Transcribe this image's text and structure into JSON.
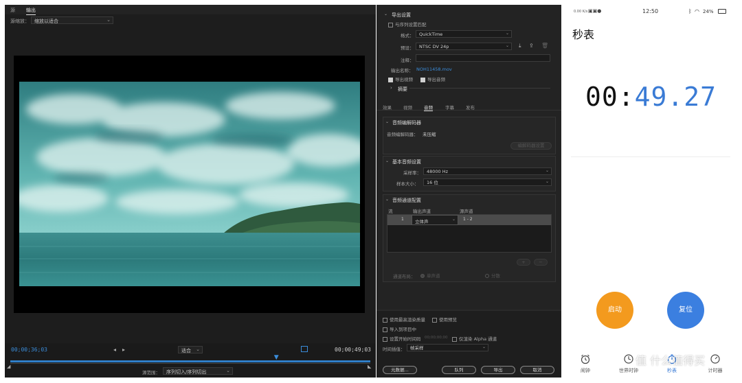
{
  "left_panel": {
    "tabs": [
      "源",
      "输出"
    ],
    "source_scale_label": "源缩放：",
    "source_scale_value": "缩放以适合",
    "timecode_current": "00;00;36;03",
    "timecode_end": "00;00;49;03",
    "fit_value": "适合",
    "source_range_label": "源范围：",
    "source_range_value": "序列切入/序列切出",
    "playhead_progress": 0.74
  },
  "export_settings": {
    "section_title": "导出设置",
    "match_sequence_label": "与序列设置匹配",
    "format_label": "格式：",
    "format_value": "QuickTime",
    "preset_label": "预设：",
    "preset_value": "NTSC DV 24p",
    "comment_label": "注释：",
    "comment_value": "",
    "output_name_label": "输出名称：",
    "output_name_value": "NOH11458.mov",
    "export_video_label": "导出视频",
    "export_audio_label": "导出音频",
    "summary_label": "摘要",
    "tabs": [
      "效果",
      "视频",
      "音频",
      "字幕",
      "发布"
    ],
    "active_tab": "音频",
    "audio_codec_section": "音频编解码器",
    "audio_codec_label": "音频编解码器：",
    "audio_codec_value": "未压缩",
    "codec_settings_button": "编解码器设置",
    "basic_audio_section": "基本音频设置",
    "sample_rate_label": "采样率：",
    "sample_rate_value": "48000 Hz",
    "sample_size_label": "样本大小：",
    "sample_size_value": "16 位",
    "channel_config_section": "音频通道配置",
    "channel_table_headers": [
      "流",
      "输出声道",
      "源声道"
    ],
    "channel_rows": [
      {
        "stream": "1",
        "output": "立体声",
        "source": "1 - 2"
      }
    ],
    "channel_layout_label": "通道布局：",
    "channel_layout_options": [
      "单声道",
      "分散"
    ],
    "bottom": {
      "max_render_quality": "使用最高渲染质量",
      "use_previews": "使用预览",
      "import_into_project": "导入到项目中",
      "set_start_timecode": "设置开始时间码",
      "start_timecode_value": "00;00;00;00",
      "render_alpha_only": "仅渲染 Alpha 通道",
      "time_interpolation_label": "时间插值：",
      "time_interpolation_value": "帧采样",
      "metadata_button": "元数据...",
      "queue_button": "队列",
      "export_button": "导出",
      "cancel_button": "取消"
    }
  },
  "phone": {
    "status_time": "12:50",
    "status_network": "0.00 K/s",
    "battery": "24%",
    "title": "秒表",
    "time_minutes": "00:",
    "time_seconds": "49.27",
    "start_button": "启动",
    "reset_button": "复位",
    "nav": [
      {
        "label": "闹钟",
        "icon": "alarm-clock-icon"
      },
      {
        "label": "世界时钟",
        "icon": "world-clock-icon"
      },
      {
        "label": "秒表",
        "icon": "stopwatch-icon"
      },
      {
        "label": "计时器",
        "icon": "timer-icon"
      }
    ],
    "active_nav": "秒表"
  },
  "watermark": "值 什么值得买",
  "colors": {
    "accent_blue": "#3a7bd5",
    "start_orange": "#f39a1e",
    "reset_blue": "#3b7fe0",
    "premiere_blue": "#3b8ddb",
    "panel_dark": "#1d1d1d"
  }
}
